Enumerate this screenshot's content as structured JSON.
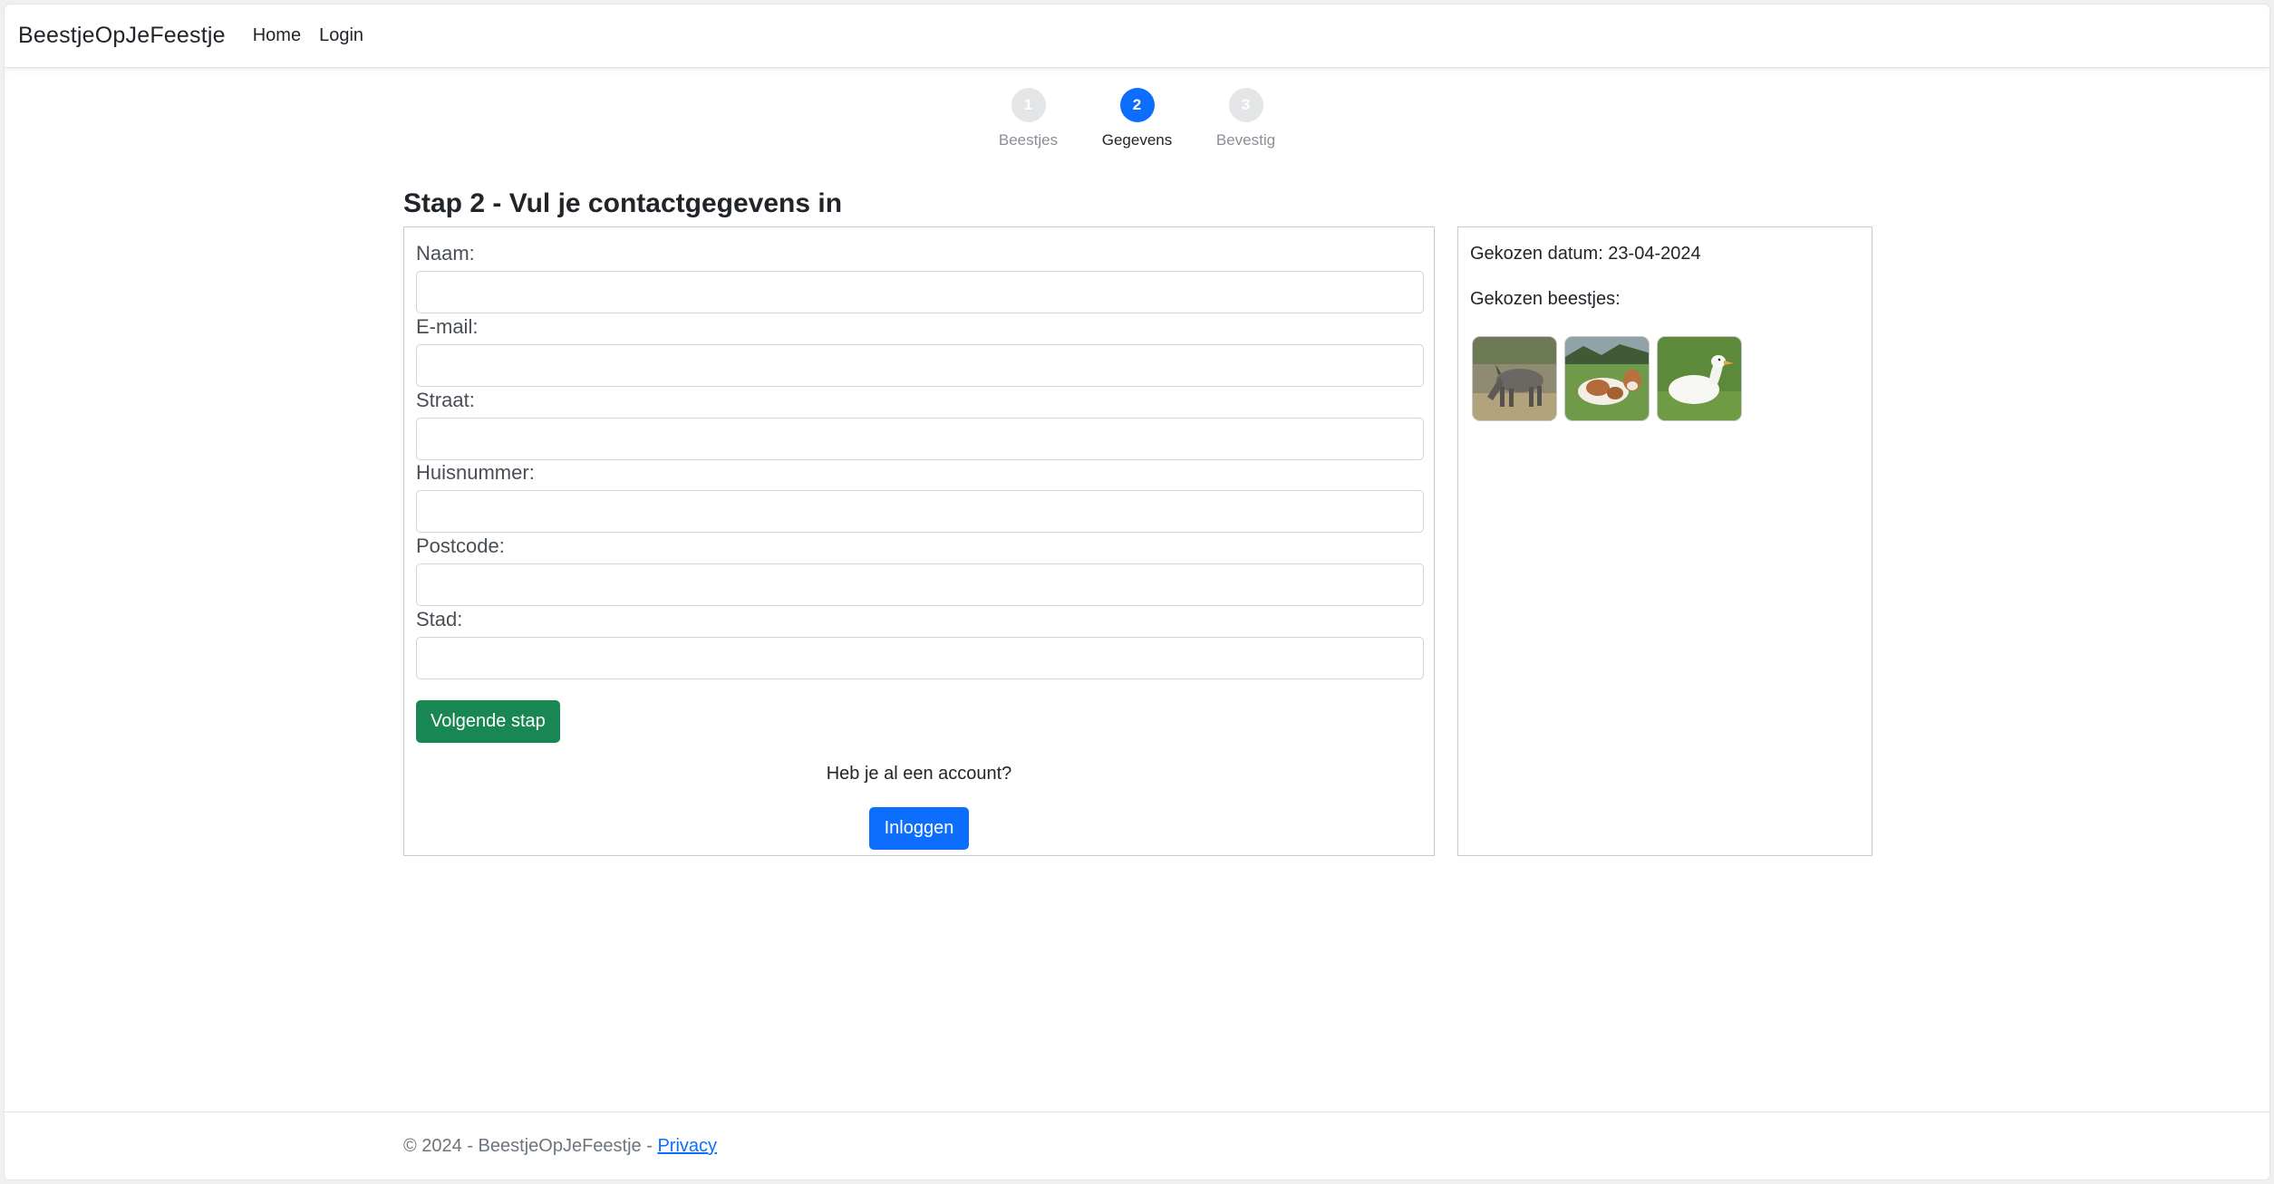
{
  "navbar": {
    "brand": "BeestjeOpJeFeestje",
    "links": [
      "Home",
      "Login"
    ]
  },
  "stepper": {
    "steps": [
      {
        "number": "1",
        "label": "Beestjes"
      },
      {
        "number": "2",
        "label": "Gegevens"
      },
      {
        "number": "3",
        "label": "Bevestig"
      }
    ],
    "active_step": 2
  },
  "page_title": "Stap 2 - Vul je contactgegevens in",
  "form": {
    "fields": [
      {
        "label": "Naam:",
        "value": ""
      },
      {
        "label": "E-mail:",
        "value": ""
      },
      {
        "label": "Straat:",
        "value": ""
      },
      {
        "label": "Huisnummer:",
        "value": ""
      },
      {
        "label": "Postcode:",
        "value": ""
      },
      {
        "label": "Stad:",
        "value": ""
      }
    ],
    "next_button": "Volgende stap",
    "account_question": "Heb je al een account?",
    "login_button": "Inloggen"
  },
  "summary": {
    "date_line": "Gekozen datum: 23-04-2024",
    "animals_label": "Gekozen beestjes:",
    "animals": [
      "donkey-photo",
      "cow-photo",
      "duck-photo"
    ]
  },
  "footer": {
    "text": "© 2024 - BeestjeOpJeFeestje - ",
    "privacy_link": "Privacy"
  },
  "colors": {
    "primary": "#0d6efd",
    "success": "#198754",
    "step_inactive": "#e3e5e7"
  }
}
